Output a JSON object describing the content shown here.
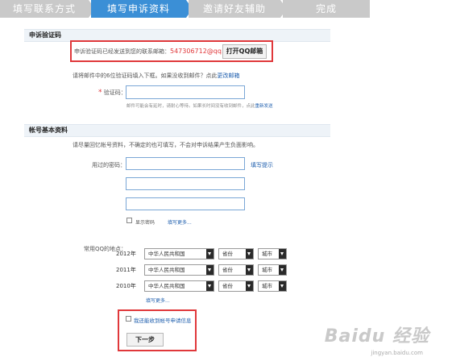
{
  "steps": [
    {
      "label": "填写联系方式"
    },
    {
      "label": "填写申诉资料"
    },
    {
      "label": "邀请好友辅助"
    },
    {
      "label": "完成"
    }
  ],
  "appeal_code": {
    "section_title": "申诉验证码",
    "sent_text": "申诉验证码已经发送到您的联系邮箱：",
    "email": "547306712@qq.com",
    "open_mail_button": "打开QQ邮箱",
    "instruction": "请将邮件中的6位验证码填入下框。如果没收到邮件？点此",
    "change_email_link": "更改邮箱",
    "code_label": "验证码：",
    "required_mark": "*",
    "code_value": "",
    "code_hint": "邮件可能会有延时，请耐心等待。如果长时间没有收到邮件，点此",
    "resend_link": "重新发送"
  },
  "account_info": {
    "section_title": "帐号基本资料",
    "intro": "请尽量回忆帐号资料，不确定的也可填写，不会对申诉结果产生负面影响。",
    "old_password_label": "用过的密码：",
    "fill_tip_link": "填写提示",
    "passwords": [
      "",
      "",
      ""
    ],
    "show_password_label": "显示密码",
    "more_link": "填写更多...",
    "location_label": "常用QQ的地点：",
    "locations": [
      {
        "year": "2012年",
        "country": "中华人民共和国",
        "province": "省份",
        "city": "城市"
      },
      {
        "year": "2011年",
        "country": "中华人民共和国",
        "province": "省份",
        "city": "城市"
      },
      {
        "year": "2010年",
        "country": "中华人民共和国",
        "province": "省份",
        "city": "城市"
      }
    ],
    "more_link2": "填写更多..."
  },
  "footer": {
    "checkbox_label": "我还能收到帐号申请信息",
    "next_button": "下一步"
  },
  "watermark": {
    "logo": "Baidu 经验",
    "url": "jingyan.baidu.com"
  }
}
